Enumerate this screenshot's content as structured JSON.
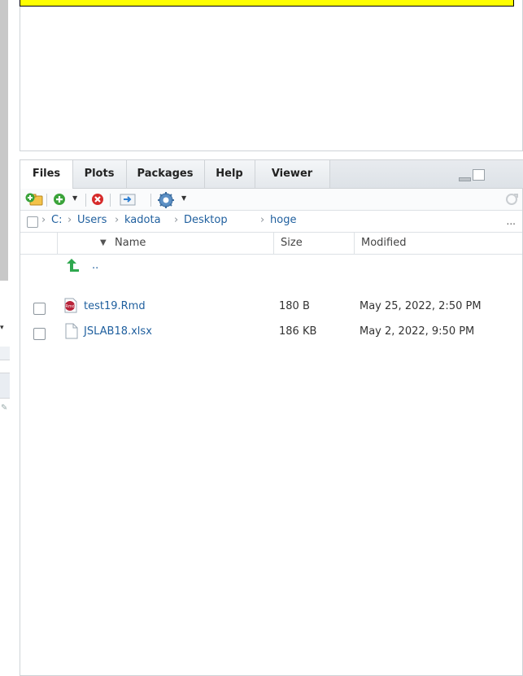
{
  "tabs": [
    {
      "label": "Files",
      "active": true
    },
    {
      "label": "Plots",
      "active": false
    },
    {
      "label": "Packages",
      "active": false
    },
    {
      "label": "Help",
      "active": false
    },
    {
      "label": "Viewer",
      "active": false
    }
  ],
  "toolbar": {
    "icons": [
      "new-folder-icon",
      "new-file-icon",
      "delete-icon",
      "rename-icon",
      "gear-icon",
      "refresh-icon"
    ]
  },
  "breadcrumb": {
    "items": [
      "C:",
      "Users",
      "kadota",
      "Desktop",
      "hoge"
    ],
    "more": "..."
  },
  "columns": {
    "name": "Name",
    "size": "Size",
    "modified": "Modified",
    "sort_indicator": "▼"
  },
  "parent_dir": {
    "label": ".."
  },
  "files": [
    {
      "name": "test19.Rmd",
      "size": "180 B",
      "modified": "May 25, 2022, 2:50 PM",
      "icon": "rmd-file-icon"
    },
    {
      "name": "JSLAB18.xlsx",
      "size": "186 KB",
      "modified": "May 2, 2022, 9:50 PM",
      "icon": "blank-file-icon"
    }
  ],
  "colors": {
    "link": "#1f5f9e",
    "highlight": "#ffff00",
    "tab_bg": "#e4e8ec"
  }
}
